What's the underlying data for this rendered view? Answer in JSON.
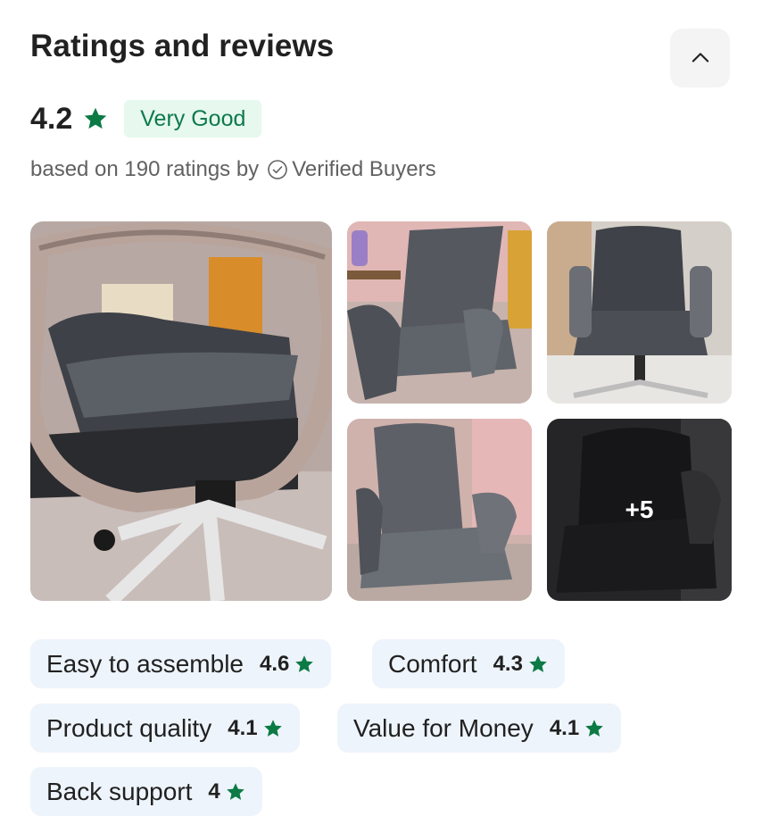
{
  "header": {
    "title": "Ratings and reviews",
    "collapse_icon": "chevron-up-icon"
  },
  "summary": {
    "average_rating": "4.2",
    "rating_icon": "star-icon",
    "rating_label": "Very Good",
    "based_on_text": "based on 190 ratings by",
    "verified_icon": "check-circle-icon",
    "verified_text": "Verified Buyers"
  },
  "gallery": {
    "photos": [
      {
        "name": "review-photo-1",
        "alt": "office chair armrest close-up"
      },
      {
        "name": "review-photo-2",
        "alt": "grey office chair side view"
      },
      {
        "name": "review-photo-3",
        "alt": "grey office chair front view"
      },
      {
        "name": "review-photo-4",
        "alt": "grey office chair angled view"
      },
      {
        "name": "review-photo-5",
        "alt": "dark office chair"
      }
    ],
    "more_count_label": "+5"
  },
  "aspects": [
    {
      "label": "Easy to assemble",
      "rating": "4.6"
    },
    {
      "label": "Comfort",
      "rating": "4.3"
    },
    {
      "label": "Product quality",
      "rating": "4.1"
    },
    {
      "label": "Value for Money",
      "rating": "4.1"
    },
    {
      "label": "Back support",
      "rating": "4"
    }
  ],
  "colors": {
    "star_green": "#0b7a44",
    "badge_bg": "#e7f8ef",
    "badge_text": "#0d7a4b",
    "chip_bg": "#eef4fb"
  }
}
